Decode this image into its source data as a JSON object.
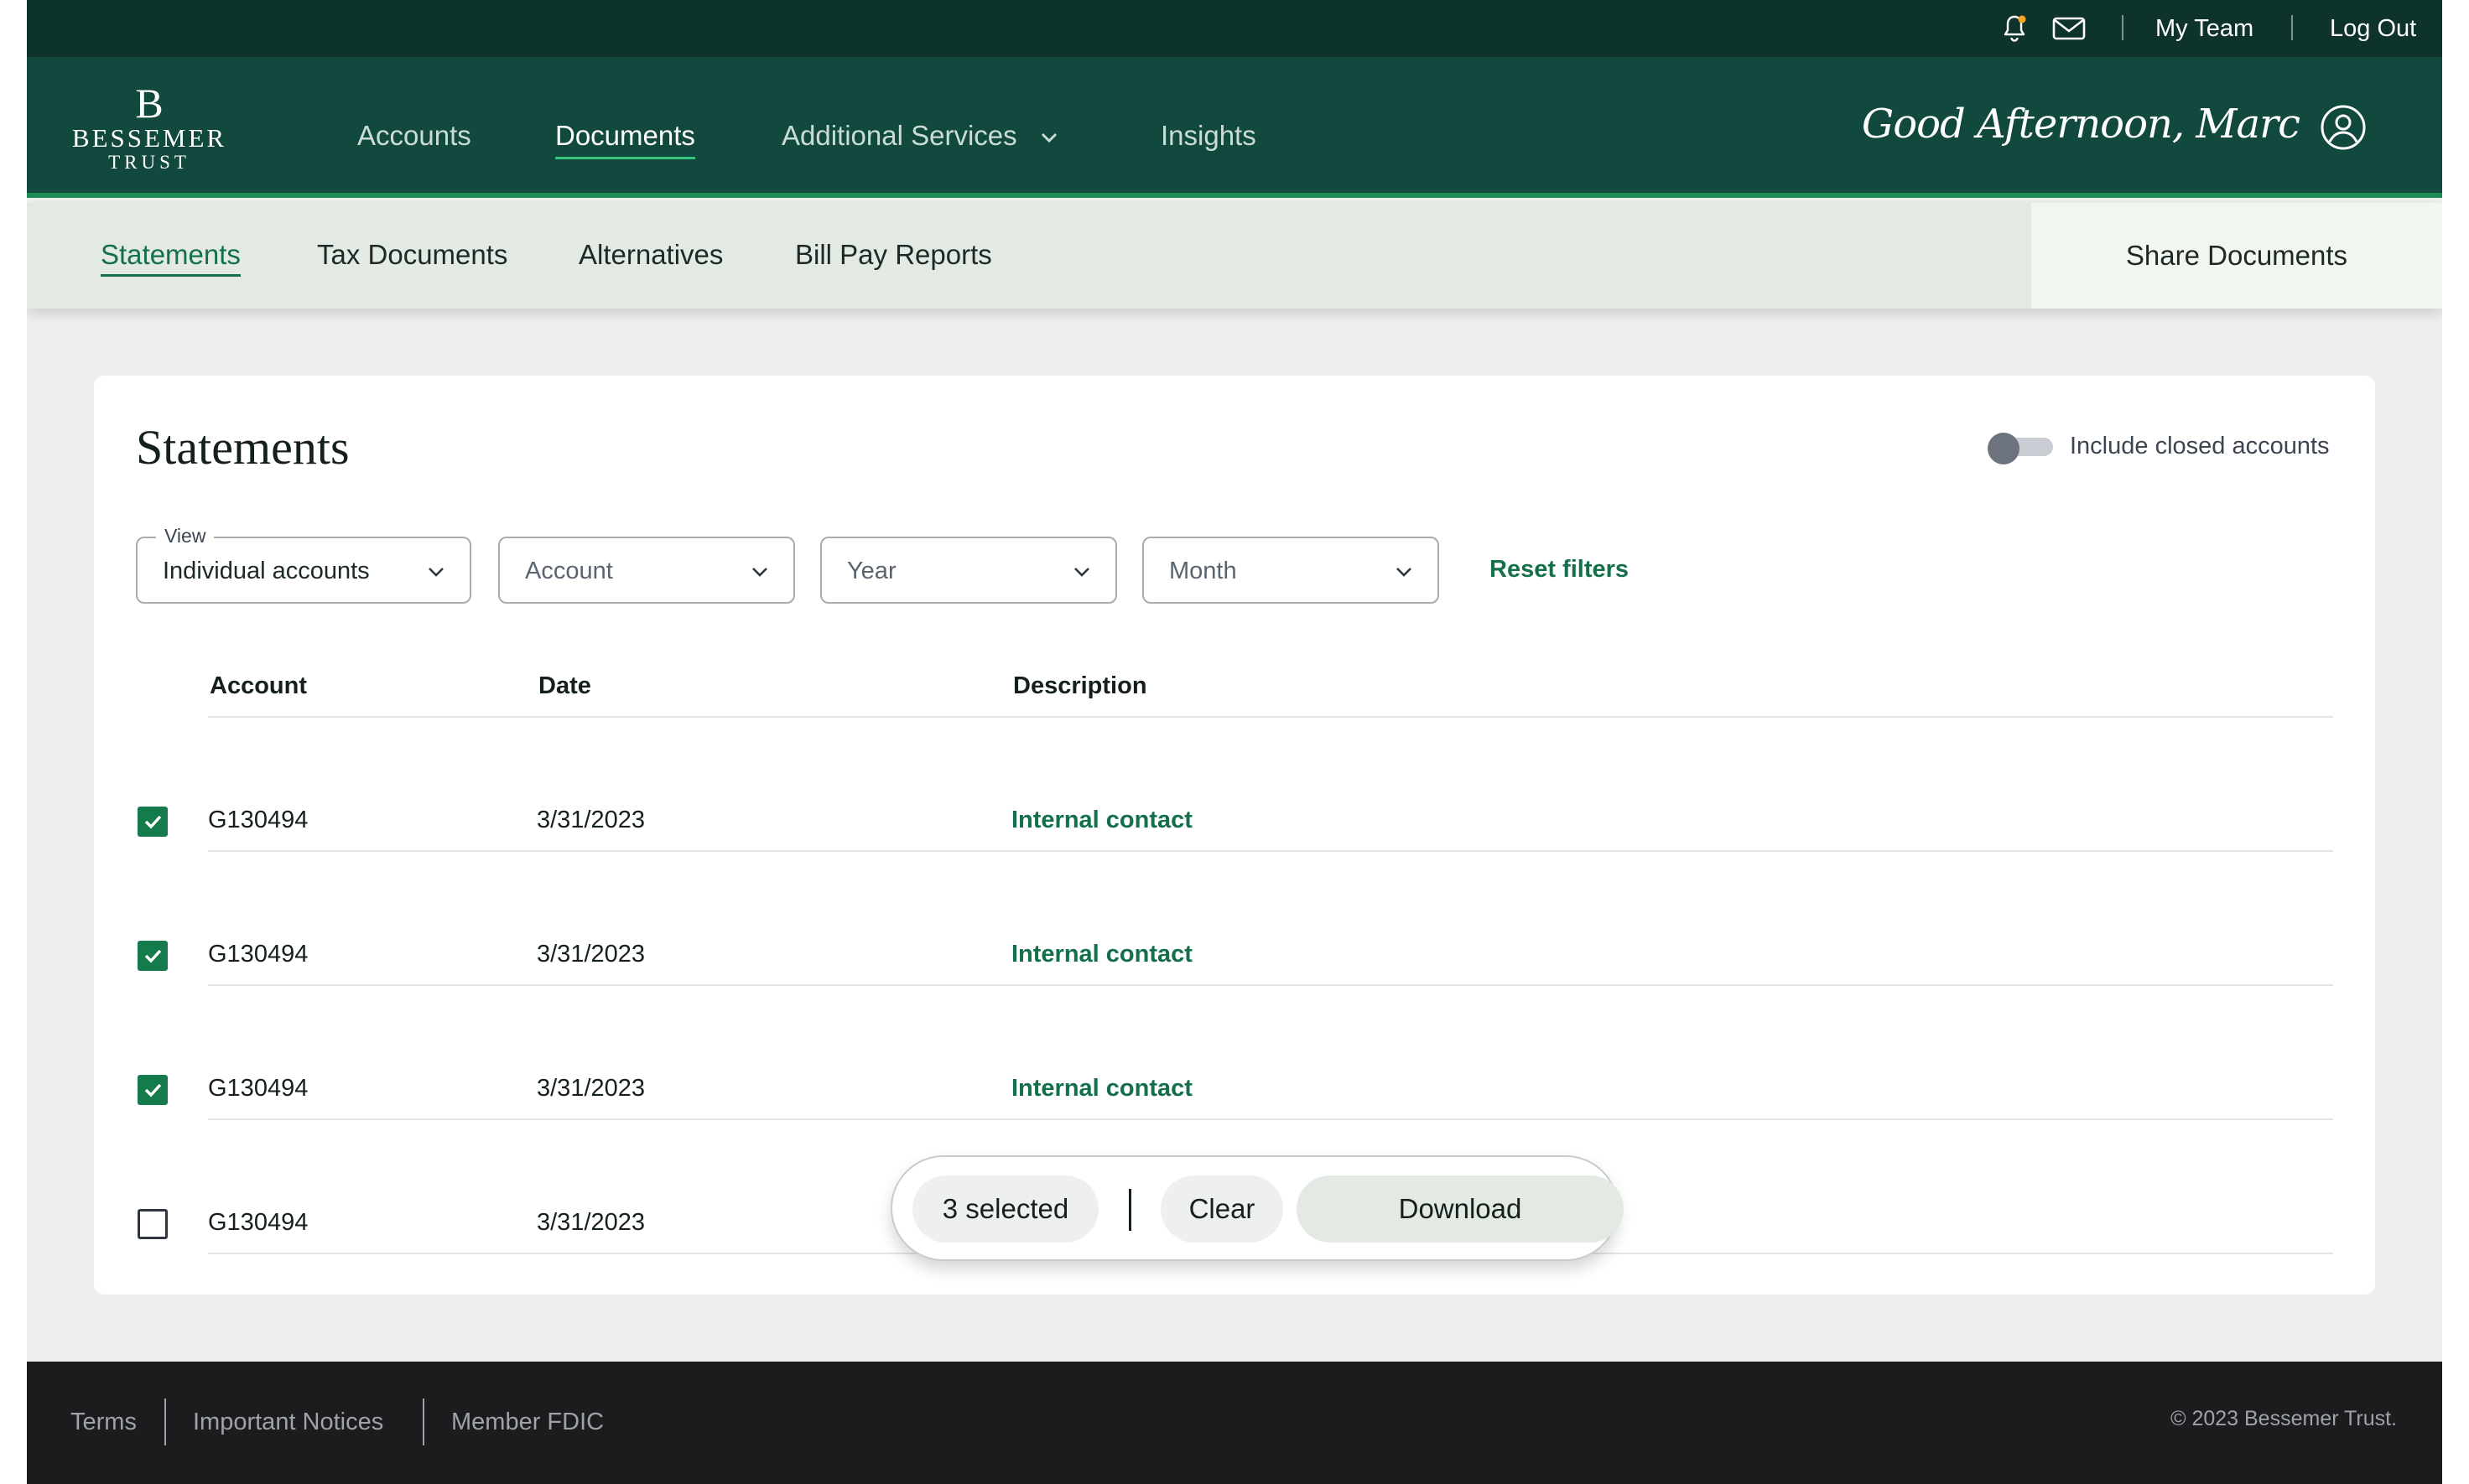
{
  "colors": {
    "utility_bar": "#0e332c",
    "nav": "#11493f",
    "nav_accent": "#37c27e",
    "brand_green": "#13704a",
    "subnav": "#e3e9e3",
    "footer": "#1c1c1e"
  },
  "utility": {
    "icons": [
      "bell-icon",
      "mail-icon"
    ],
    "links": [
      "My Team",
      "Log Out"
    ]
  },
  "brand": {
    "monogram": "B",
    "name_line1": "BESSEMER",
    "name_line2": "TRUST"
  },
  "nav": {
    "items": [
      {
        "label": "Accounts"
      },
      {
        "label": "Documents"
      },
      {
        "label": "Additional Services"
      },
      {
        "label": "Insights"
      }
    ],
    "active": "Documents",
    "greeting": "Good Afternoon, Marc"
  },
  "subnav": {
    "tabs": [
      {
        "label": "Statements"
      },
      {
        "label": "Tax Documents"
      },
      {
        "label": "Alternatives"
      },
      {
        "label": "Bill Pay Reports"
      }
    ],
    "active": "Statements",
    "share_label": "Share Documents"
  },
  "main": {
    "title": "Statements",
    "toggle_label": "Include closed accounts",
    "toggle_on": false,
    "filters": {
      "view_label": "View",
      "view_value": "Individual accounts",
      "account_placeholder": "Account",
      "year_placeholder": "Year",
      "month_placeholder": "Month",
      "reset_label": "Reset filters"
    },
    "table": {
      "headers": [
        "Account",
        "Date",
        "Description"
      ],
      "rows": [
        {
          "checked": true,
          "account": "G130494",
          "date": "3/31/2023",
          "description": "Internal contact"
        },
        {
          "checked": true,
          "account": "G130494",
          "date": "3/31/2023",
          "description": "Internal contact"
        },
        {
          "checked": true,
          "account": "G130494",
          "date": "3/31/2023",
          "description": "Internal contact"
        },
        {
          "checked": false,
          "account": "G130494",
          "date": "3/31/2023",
          "description": ""
        }
      ]
    }
  },
  "selection_bar": {
    "count_label": "3 selected",
    "clear_label": "Clear",
    "download_label": "Download"
  },
  "footer": {
    "links": [
      "Terms",
      "Important Notices",
      "Member FDIC"
    ],
    "copyright": "© 2023 Bessemer Trust."
  }
}
